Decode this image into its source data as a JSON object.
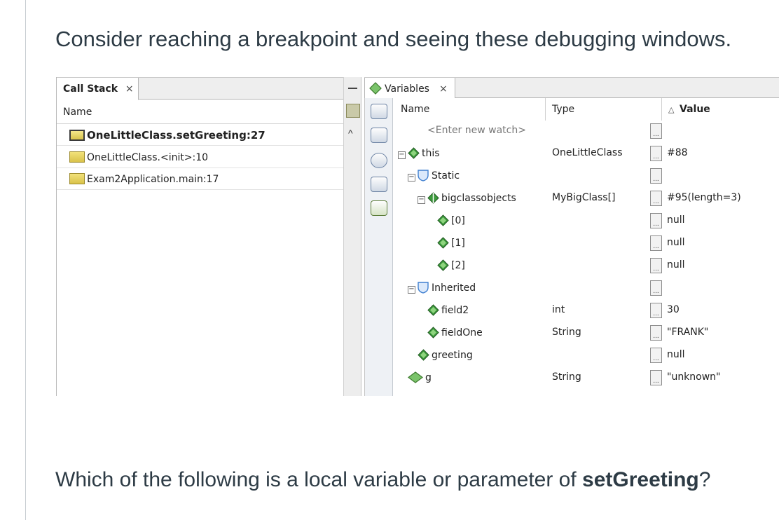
{
  "question": {
    "intro": "Consider reaching a breakpoint and seeing these debugging windows.",
    "body_prefix": "Which of the following is a local variable or parameter of ",
    "body_bold": "setGreeting",
    "body_suffix": "?"
  },
  "call_stack": {
    "tab_label": "Call Stack",
    "tab_close": "×",
    "column_name": "Name",
    "frames": [
      {
        "label": "OneLittleClass.setGreeting:27",
        "current": true
      },
      {
        "label": "OneLittleClass.<init>:10",
        "current": false
      },
      {
        "label": "Exam2Application.main:17",
        "current": false
      }
    ],
    "scroll_up": "^"
  },
  "variables": {
    "tab_label": "Variables",
    "tab_close": "×",
    "columns": {
      "name": "Name",
      "type": "Type",
      "value": "Value",
      "value_sort_icon": "△"
    },
    "watch_placeholder": "<Enter new watch>",
    "ellipsis": "...",
    "rows": [
      {
        "name": "this",
        "type": "OneLittleClass",
        "value": "#88"
      },
      {
        "name": "Static",
        "type": "",
        "value": ""
      },
      {
        "name": "bigclassobjects",
        "type": "MyBigClass[]",
        "value": "#95(length=3)"
      },
      {
        "name": "[0]",
        "type": "",
        "value": "null"
      },
      {
        "name": "[1]",
        "type": "",
        "value": "null"
      },
      {
        "name": "[2]",
        "type": "",
        "value": "null"
      },
      {
        "name": "Inherited",
        "type": "",
        "value": ""
      },
      {
        "name": "field2",
        "type": "int",
        "value": "30"
      },
      {
        "name": "fieldOne",
        "type": "String",
        "value": "\"FRANK\""
      },
      {
        "name": "greeting",
        "type": "",
        "value": "null"
      },
      {
        "name": "g",
        "type": "String",
        "value": "\"unknown\""
      }
    ],
    "toolbar_icons": [
      "new-watch-icon",
      "watch-expression-icon",
      "add-breakpoint-icon",
      "show-classes-icon",
      "export-icon"
    ]
  },
  "colors": {
    "field_diamond": "#3c9a3c",
    "local_diamond": "#7ac36a",
    "static_shield": "#6aa0e0",
    "frame_icon": "#e5d060"
  }
}
